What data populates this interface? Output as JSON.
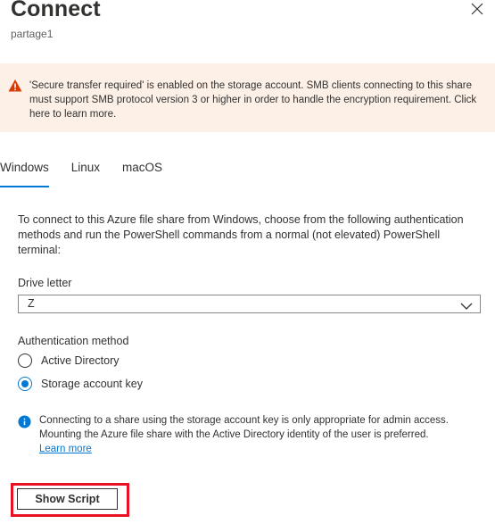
{
  "header": {
    "title": "Connect",
    "subtitle": "partage1"
  },
  "warning": {
    "text": "'Secure transfer required' is enabled on the storage account. SMB clients connecting to this share must support SMB protocol version 3 or higher in order to handle the encryption requirement. Click here to learn more.",
    "icon": "warning-icon",
    "color": "#d83b01"
  },
  "tabs": [
    {
      "label": "Windows",
      "active": true
    },
    {
      "label": "Linux",
      "active": false
    },
    {
      "label": "macOS",
      "active": false
    }
  ],
  "description": "To connect to this Azure file share from Windows, choose from the following authentication methods and run the PowerShell commands from a normal (not elevated) PowerShell terminal:",
  "drive_letter": {
    "label": "Drive letter",
    "value": "Z"
  },
  "auth": {
    "label": "Authentication method",
    "options": [
      {
        "label": "Active Directory",
        "selected": false
      },
      {
        "label": "Storage account key",
        "selected": true
      }
    ]
  },
  "info": {
    "text": "Connecting to a share using the storage account key is only appropriate for admin access. Mounting the Azure file share with the Active Directory identity of the user is preferred.",
    "link": "Learn more",
    "icon": "info-icon",
    "color": "#0078d4"
  },
  "actions": {
    "show_script": "Show Script"
  },
  "colors": {
    "accent": "#0078d4",
    "highlight": "#e81123",
    "warning_bg": "#fdf0e7"
  }
}
